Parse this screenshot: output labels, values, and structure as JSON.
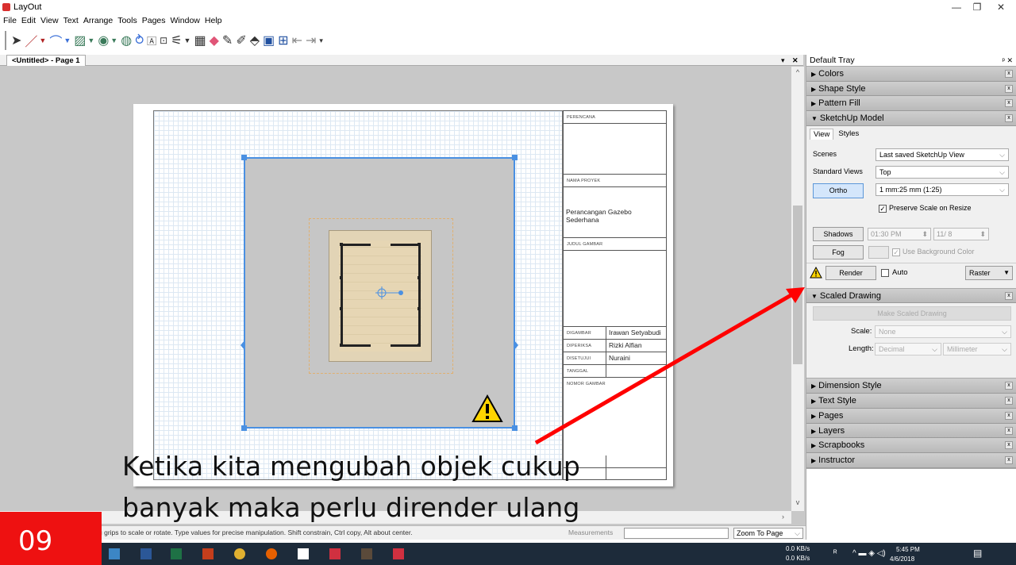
{
  "window": {
    "title": "LayOut"
  },
  "menu": [
    "File",
    "Edit",
    "View",
    "Text",
    "Arrange",
    "Tools",
    "Pages",
    "Window",
    "Help"
  ],
  "document": {
    "tab_label": "<Untitled> - Page 1"
  },
  "title_block": {
    "perencana_label": "PERENCANA",
    "nama_proyek_label": "NAMA PROYEK",
    "nama_proyek_value": "Perancangan Gazebo Sederhana",
    "judul_gambar_label": "JUDUL GAMBAR",
    "digambar_label": "DIGAMBAR",
    "digambar_value": "Irawan Setyabudi",
    "diperiksa_label": "DIPERIKSA",
    "diperiksa_value": "Rizki Alfian",
    "disetujui_label": "DISETUJUI",
    "disetujui_value": "Nuraini",
    "tanggal_label": "TANGGAL",
    "nomor_gambar_label": "NOMOR GAMBAR"
  },
  "statusbar": {
    "hint": "g grips to scale or rotate. Type values for precise manipulation. Shift constrain, Ctrl copy, Alt about center.",
    "measurements_label": "Measurements",
    "zoom": "Zoom To Page"
  },
  "tray": {
    "title": "Default Tray",
    "panels_top": [
      "Colors",
      "Shape Style",
      "Pattern Fill"
    ],
    "sketchup_model": {
      "title": "SketchUp Model",
      "tab_view": "View",
      "tab_styles": "Styles",
      "scenes_label": "Scenes",
      "scenes_value": "Last saved SketchUp View",
      "standard_views_label": "Standard Views",
      "standard_views_value": "Top",
      "ortho_label": "Ortho",
      "scale_value": "1 mm:25 mm (1:25)",
      "preserve_scale_label": "Preserve Scale on Resize",
      "shadows_label": "Shadows",
      "time_value": "01:30 PM",
      "date_value": "11/ 8",
      "fog_label": "Fog",
      "use_bg_label": "Use Background Color",
      "render_label": "Render",
      "auto_label": "Auto",
      "raster_label": "Raster"
    },
    "scaled_drawing": {
      "title": "Scaled Drawing",
      "make_button": "Make Scaled Drawing",
      "scale_label": "Scale:",
      "scale_value": "None",
      "length_label": "Length:",
      "length_value": "Decimal",
      "unit_value": "Millimeter"
    },
    "panels_bottom": [
      "Dimension Style",
      "Text Style",
      "Pages",
      "Layers",
      "Scrapbooks",
      "Instructor"
    ]
  },
  "annotation": {
    "line1": "Ketika kita mengubah objek cukup",
    "line2": "banyak maka perlu dirender ulang",
    "slide_number": "09"
  },
  "taskbar": {
    "net_up": "0.0 KB/s",
    "net_down": "0.0 KB/s",
    "time": "5:45 PM",
    "date": "4/6/2018"
  }
}
